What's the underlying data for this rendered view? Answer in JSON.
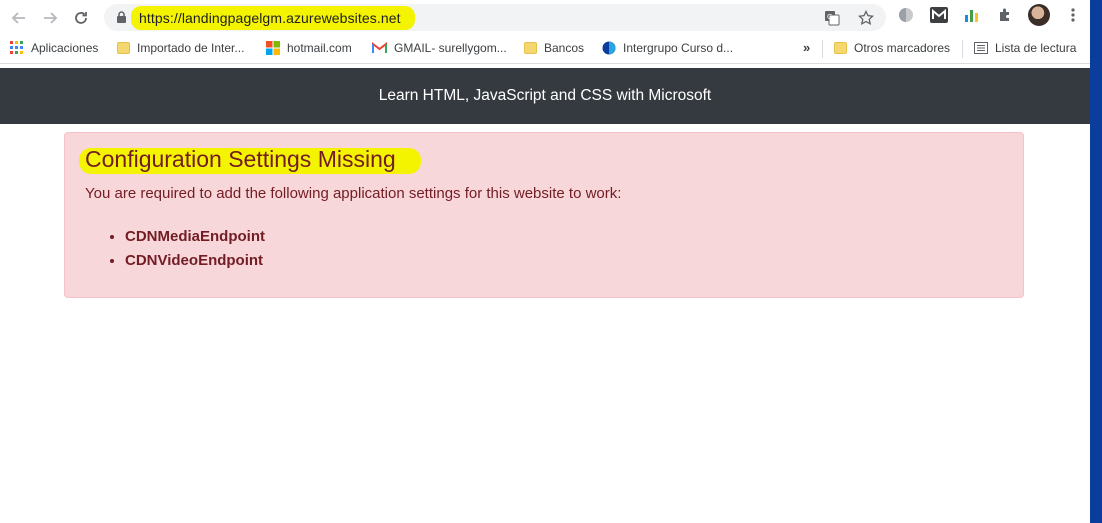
{
  "browser": {
    "url": "https://landingpagelgm.azurewebsites.net",
    "bookmarks": [
      {
        "label": "Aplicaciones",
        "icon": "apps-grid-icon"
      },
      {
        "label": "Importado de Inter...",
        "icon": "folder-icon"
      },
      {
        "label": "hotmail.com",
        "icon": "microsoft-logo-icon"
      },
      {
        "label": "GMAIL- surellygom...",
        "icon": "gmail-icon"
      },
      {
        "label": "Bancos",
        "icon": "folder-icon"
      },
      {
        "label": "Intergrupo Curso d...",
        "icon": "intergrupo-icon"
      }
    ],
    "overflow_label": "»",
    "other_bookmarks": "Otros marcadores",
    "reading_list": "Lista de lectura"
  },
  "page": {
    "navbar_title": "Learn HTML, JavaScript and CSS with Microsoft",
    "alert": {
      "heading": "Configuration Settings Missing",
      "text": "You are required to add the following application settings for this website to work:",
      "items": [
        "CDNMediaEndpoint",
        "CDNVideoEndpoint"
      ]
    }
  },
  "colors": {
    "navbar_bg": "#343a40",
    "alert_bg": "#f8d7da",
    "alert_text": "#721c24",
    "highlight": "#f4f400"
  }
}
